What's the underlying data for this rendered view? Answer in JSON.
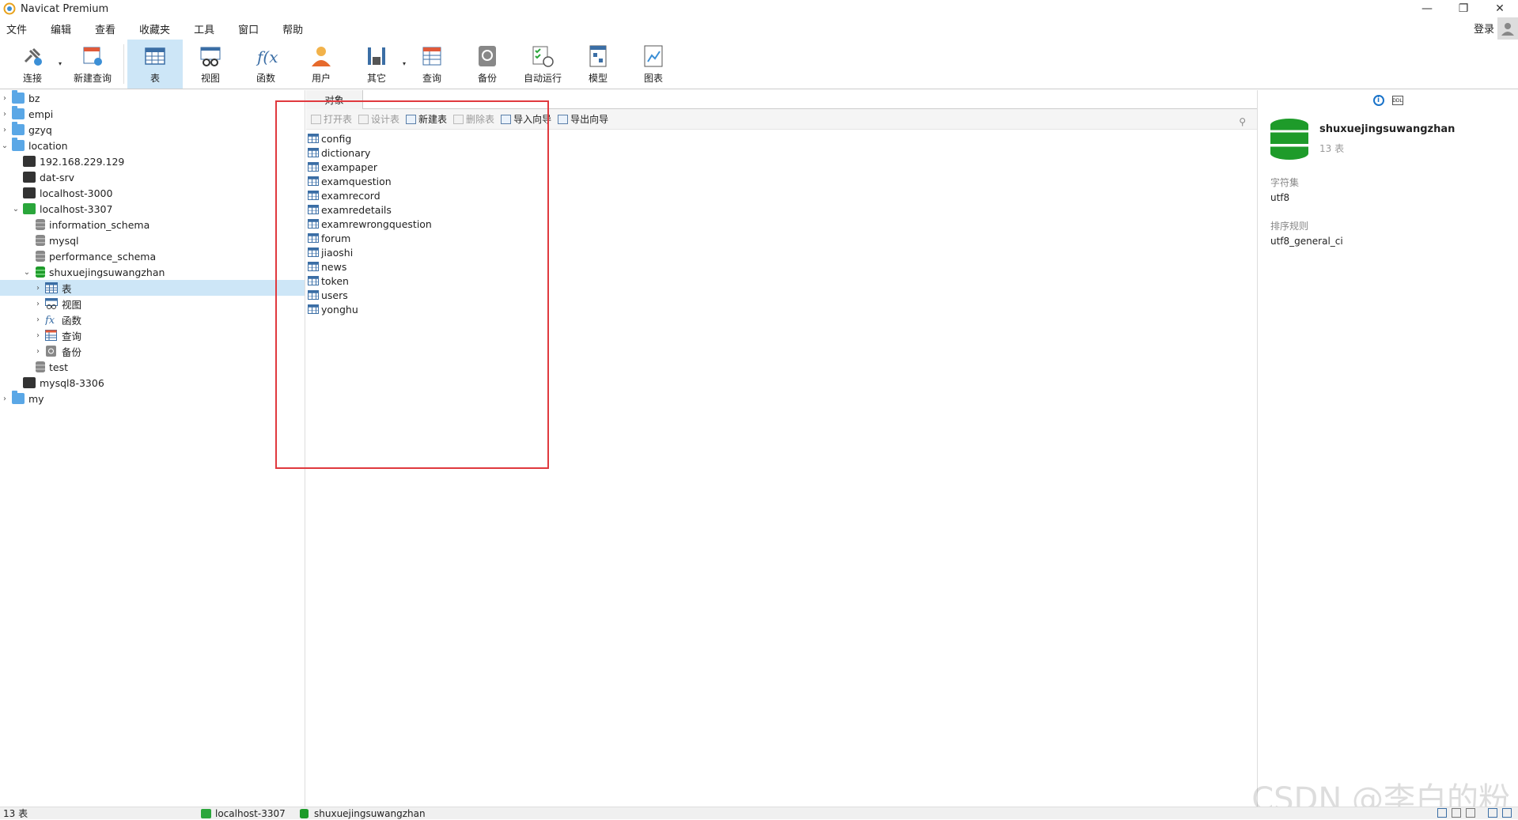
{
  "window": {
    "title": "Navicat Premium",
    "minimize": "—",
    "restore": "❐",
    "close": "✕"
  },
  "menu": [
    "文件",
    "编辑",
    "查看",
    "收藏夹",
    "工具",
    "窗口",
    "帮助"
  ],
  "login_label": "登录",
  "toolbar": [
    {
      "label": "连接",
      "icon": "plug-icon",
      "dropdown": true
    },
    {
      "label": "新建查询",
      "icon": "new-query-icon"
    },
    {
      "label": "表",
      "icon": "table-icon",
      "active": true
    },
    {
      "label": "视图",
      "icon": "view-icon"
    },
    {
      "label": "函数",
      "icon": "function-icon"
    },
    {
      "label": "用户",
      "icon": "user-icon"
    },
    {
      "label": "其它",
      "icon": "tools-icon",
      "dropdown": true
    },
    {
      "label": "查询",
      "icon": "query-icon"
    },
    {
      "label": "备份",
      "icon": "backup-icon"
    },
    {
      "label": "自动运行",
      "icon": "schedule-icon"
    },
    {
      "label": "模型",
      "icon": "model-icon"
    },
    {
      "label": "图表",
      "icon": "chart-icon"
    }
  ],
  "tree": [
    {
      "label": "bz",
      "type": "folder",
      "depth": 0,
      "expanded": false
    },
    {
      "label": "empi",
      "type": "folder",
      "depth": 0,
      "expanded": false
    },
    {
      "label": "gzyq",
      "type": "folder",
      "depth": 0,
      "expanded": false
    },
    {
      "label": "location",
      "type": "folder",
      "depth": 0,
      "expanded": true
    },
    {
      "label": "192.168.229.129",
      "type": "conn",
      "depth": 1
    },
    {
      "label": "dat-srv",
      "type": "conn",
      "depth": 1
    },
    {
      "label": "localhost-3000",
      "type": "conn",
      "depth": 1
    },
    {
      "label": "localhost-3307",
      "type": "conn-green",
      "depth": 1,
      "expanded": true
    },
    {
      "label": "information_schema",
      "type": "db",
      "depth": 2
    },
    {
      "label": "mysql",
      "type": "db",
      "depth": 2
    },
    {
      "label": "performance_schema",
      "type": "db",
      "depth": 2
    },
    {
      "label": "shuxuejingsuwangzhan",
      "type": "db-green",
      "depth": 2,
      "expanded": true
    },
    {
      "label": "表",
      "type": "tables",
      "depth": 3,
      "expanded": false,
      "selected": true
    },
    {
      "label": "视图",
      "type": "views",
      "depth": 3,
      "expanded": false
    },
    {
      "label": "函数",
      "type": "funcs",
      "depth": 3,
      "expanded": false
    },
    {
      "label": "查询",
      "type": "queries",
      "depth": 3,
      "expanded": false
    },
    {
      "label": "备份",
      "type": "backups",
      "depth": 3,
      "expanded": false
    },
    {
      "label": "test",
      "type": "db",
      "depth": 2
    },
    {
      "label": "mysql8-3306",
      "type": "conn",
      "depth": 1
    },
    {
      "label": "my",
      "type": "folder",
      "depth": 0,
      "expanded": false
    }
  ],
  "objects_tab": "对象",
  "object_toolbar": [
    {
      "label": "打开表",
      "disabled": true
    },
    {
      "label": "设计表",
      "disabled": true
    },
    {
      "label": "新建表",
      "disabled": false
    },
    {
      "label": "删除表",
      "disabled": true
    },
    {
      "label": "导入向导",
      "disabled": false
    },
    {
      "label": "导出向导",
      "disabled": false
    }
  ],
  "tables": [
    "config",
    "dictionary",
    "exampaper",
    "examquestion",
    "examrecord",
    "examredetails",
    "examrewrongquestion",
    "forum",
    "jiaoshi",
    "news",
    "token",
    "users",
    "yonghu"
  ],
  "info_panel": {
    "db_name": "shuxuejingsuwangzhan",
    "count": "13 表",
    "charset_label": "字符集",
    "charset": "utf8",
    "collation_label": "排序规则",
    "collation": "utf8_general_ci",
    "info_glyph": "i",
    "ddl_glyph": "DDL"
  },
  "status": {
    "count": "13 表",
    "connection": "localhost-3307",
    "database": "shuxuejingsuwangzhan"
  },
  "watermark": "CSDN @李白的粉"
}
